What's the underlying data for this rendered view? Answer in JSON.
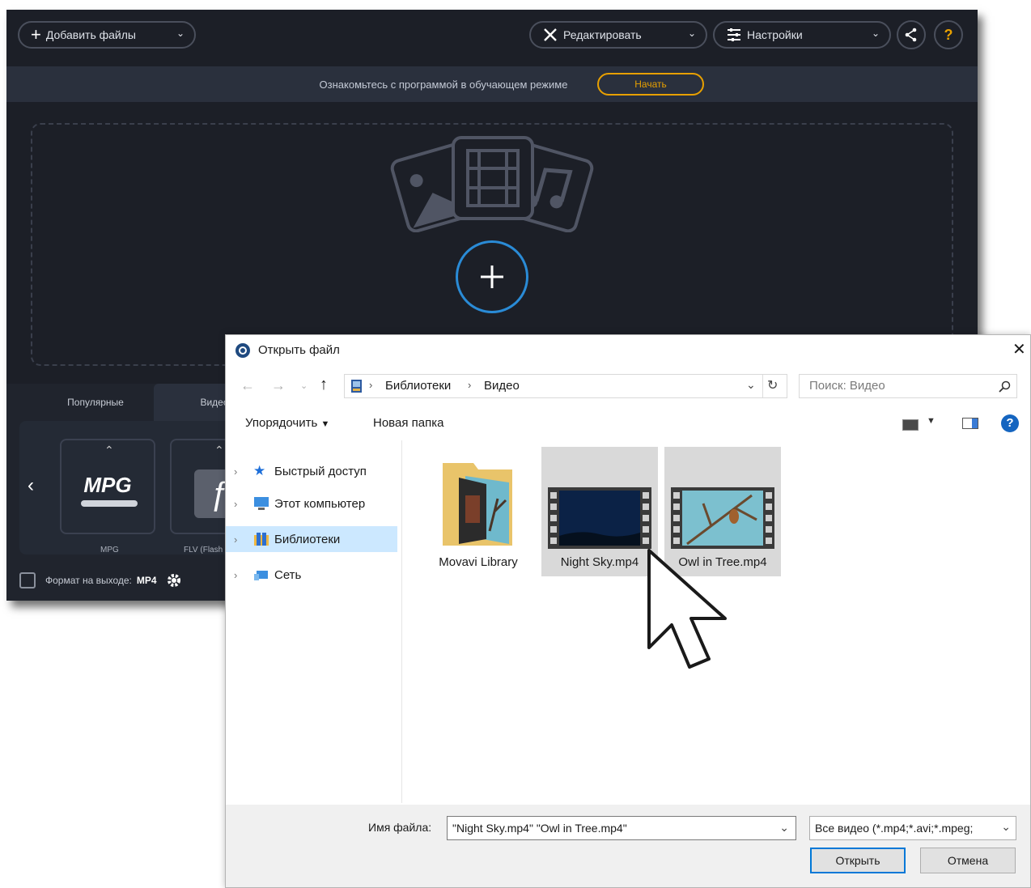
{
  "app": {
    "add_files_label": "Добавить файлы",
    "edit_label": "Редактировать",
    "settings_label": "Настройки",
    "banner_text": "Ознакомьтесь с программой в обучающем режиме",
    "start_label": "Начать",
    "tabs": [
      {
        "label": "Популярные"
      },
      {
        "label": "Видео"
      }
    ],
    "formats": [
      {
        "name": "MPG",
        "caption": "MPG"
      },
      {
        "name": "FLV",
        "caption": "FLV (Flash"
      }
    ],
    "output_label": "Формат на выходе:",
    "output_value": "MP4",
    "colors": {
      "accent_orange": "#e8a000",
      "accent_blue": "#2a8bd6",
      "bg": "#1c1f27"
    }
  },
  "dialog": {
    "title": "Открыть файл",
    "breadcrumb": [
      "Библиотеки",
      "Видео"
    ],
    "search_placeholder": "Поиск: Видео",
    "toolbar": {
      "organize_label": "Упорядочить",
      "new_folder_label": "Новая папка"
    },
    "nav": [
      {
        "label": "Быстрый доступ",
        "icon": "star-icon"
      },
      {
        "label": "Этот компьютер",
        "icon": "computer-icon"
      },
      {
        "label": "Библиотеки",
        "icon": "libraries-icon",
        "selected": true
      },
      {
        "label": "Сеть",
        "icon": "network-icon"
      }
    ],
    "files": [
      {
        "name": "Movavi Library",
        "type": "folder"
      },
      {
        "name": "Night Sky.mp4",
        "type": "video",
        "selected": true
      },
      {
        "name": "Owl in Tree.mp4",
        "type": "video",
        "selected": true
      }
    ],
    "filename_label": "Имя файла:",
    "filename_value": "\"Night Sky.mp4\" \"Owl in Tree.mp4\"",
    "filetype_value": "Все видео (*.mp4;*.avi;*.mpeg;",
    "open_label": "Открыть",
    "cancel_label": "Отмена",
    "close_glyph": "✕"
  }
}
